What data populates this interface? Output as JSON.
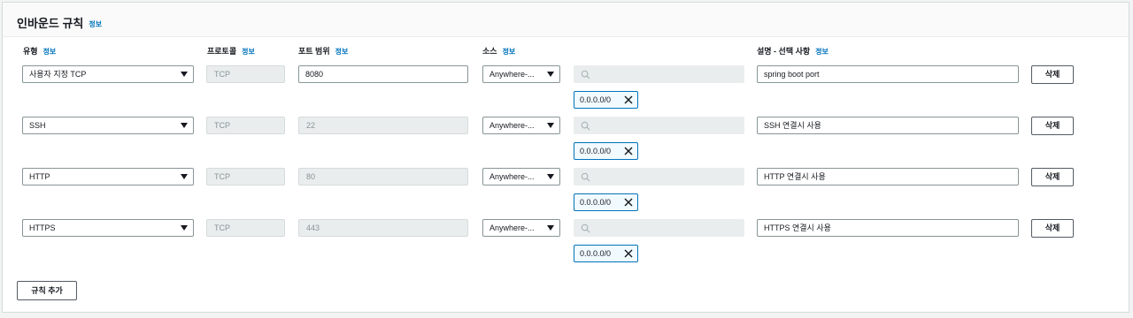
{
  "panel": {
    "title": "인바운드 규칙",
    "info": "정보"
  },
  "columns": {
    "type": "유형",
    "protocol": "프로토콜",
    "port_range": "포트 범위",
    "source": "소스",
    "description": "설명 - 선택 사항",
    "info": "정보"
  },
  "rules": [
    {
      "type": "사용자 지정 TCP",
      "protocol": "TCP",
      "port": "8080",
      "port_editable": true,
      "source": "Anywhere-...",
      "cidr": "0.0.0.0/0",
      "description": "spring boot port",
      "delete": "삭제"
    },
    {
      "type": "SSH",
      "protocol": "TCP",
      "port": "22",
      "port_editable": false,
      "source": "Anywhere-...",
      "cidr": "0.0.0.0/0",
      "description": "SSH 연결시 사용",
      "delete": "삭제"
    },
    {
      "type": "HTTP",
      "protocol": "TCP",
      "port": "80",
      "port_editable": false,
      "source": "Anywhere-...",
      "cidr": "0.0.0.0/0",
      "description": "HTTP 연결시 사용",
      "delete": "삭제"
    },
    {
      "type": "HTTPS",
      "protocol": "TCP",
      "port": "443",
      "port_editable": false,
      "source": "Anywhere-...",
      "cidr": "0.0.0.0/0",
      "description": "HTTPS 연결시 사용",
      "delete": "삭제"
    }
  ],
  "add_rule_button": "규칙 추가",
  "icons": {
    "dropdown": "caret-down-icon",
    "search": "search-icon",
    "remove": "close-icon"
  },
  "colors": {
    "link": "#0073bb",
    "token_border": "#0073bb",
    "disabled_bg": "#eaeded"
  }
}
